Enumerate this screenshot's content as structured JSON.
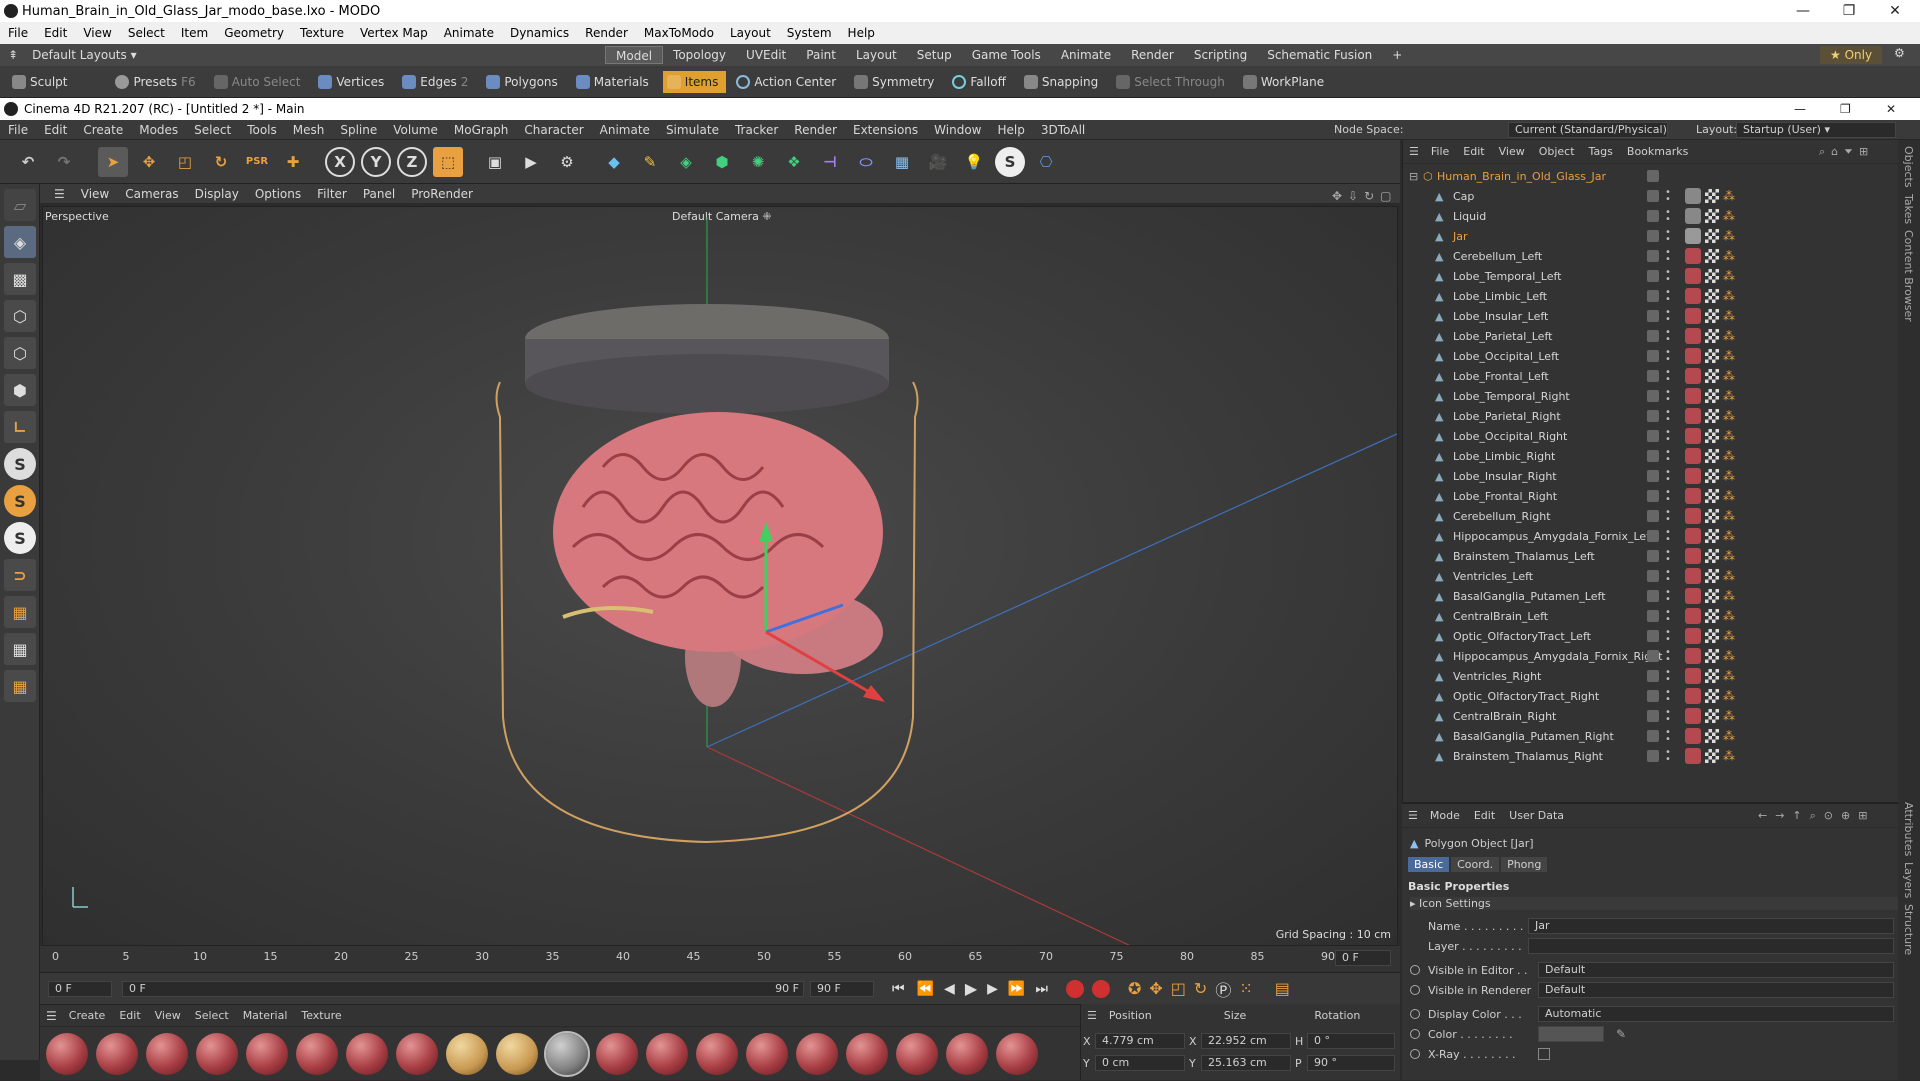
{
  "modo": {
    "title": "Human_Brain_in_Old_Glass_Jar_modo_base.lxo - MODO",
    "menu": [
      "File",
      "Edit",
      "View",
      "Select",
      "Item",
      "Geometry",
      "Texture",
      "Vertex Map",
      "Animate",
      "Dynamics",
      "Render",
      "MaxToModo",
      "Layout",
      "System",
      "Help"
    ],
    "layout_label": "Default Layouts",
    "tabs": [
      "Model",
      "Topology",
      "UVEdit",
      "Paint",
      "Layout",
      "Setup",
      "Game Tools",
      "Animate",
      "Render",
      "Scripting",
      "Schematic Fusion"
    ],
    "only_label": "Only",
    "tools": [
      "Sculpt",
      "Presets",
      "Auto Select",
      "Vertices",
      "Edges",
      "Polygons",
      "Materials",
      "Items",
      "Action Center",
      "Symmetry",
      "Falloff",
      "Snapping",
      "Select Through",
      "WorkPlane"
    ],
    "presets_key": "F6",
    "edges_count": "2"
  },
  "c4d": {
    "title": "Cinema 4D R21.207 (RC) - [Untitled 2 *] - Main",
    "menu": [
      "File",
      "Edit",
      "Create",
      "Modes",
      "Select",
      "Tools",
      "Mesh",
      "Spline",
      "Volume",
      "MoGraph",
      "Character",
      "Animate",
      "Simulate",
      "Tracker",
      "Render",
      "Extensions",
      "Window",
      "Help",
      "3DToAll"
    ],
    "node_space_label": "Node Space:",
    "node_space_value": "Current (Standard/Physical)",
    "layout_label": "Layout:",
    "layout_value": "Startup (User)"
  },
  "viewport": {
    "menu": [
      "View",
      "Cameras",
      "Display",
      "Options",
      "Filter",
      "Panel",
      "ProRender"
    ],
    "label": "Perspective",
    "camera": "Default Camera",
    "grid": "Grid Spacing : 10 cm"
  },
  "timeline": {
    "ticks": [
      "0",
      "5",
      "10",
      "15",
      "20",
      "25",
      "30",
      "35",
      "40",
      "45",
      "50",
      "55",
      "60",
      "65",
      "70",
      "75",
      "80",
      "85",
      "90"
    ],
    "end": "0 F",
    "start_field": "0 F",
    "range_start": "0 F",
    "range_end": "90 F",
    "end_field": "90 F"
  },
  "materials": {
    "menu": [
      "Create",
      "Edit",
      "View",
      "Select",
      "Material",
      "Texture"
    ]
  },
  "coords": {
    "headers": [
      "Position",
      "Size",
      "Rotation"
    ],
    "x_pos": "4.779 cm",
    "x_size": "22.952 cm",
    "h_rot": "0 °",
    "y_pos": "0 cm",
    "y_size": "25.163 cm",
    "p_rot": "90 °",
    "x": "X",
    "y": "Y",
    "h": "H",
    "p": "P"
  },
  "objects": {
    "menu": [
      "File",
      "Edit",
      "View",
      "Object",
      "Tags",
      "Bookmarks"
    ],
    "root": "Human_Brain_in_Old_Glass_Jar",
    "items": [
      "Cap",
      "Liquid",
      "Jar",
      "Cerebellum_Left",
      "Lobe_Temporal_Left",
      "Lobe_Limbic_Left",
      "Lobe_Insular_Left",
      "Lobe_Parietal_Left",
      "Lobe_Occipital_Left",
      "Lobe_Frontal_Left",
      "Lobe_Temporal_Right",
      "Lobe_Parietal_Right",
      "Lobe_Occipital_Right",
      "Lobe_Limbic_Right",
      "Lobe_Insular_Right",
      "Lobe_Frontal_Right",
      "Cerebellum_Right",
      "Hippocampus_Amygdala_Fornix_Left",
      "Brainstem_Thalamus_Left",
      "Ventricles_Left",
      "BasalGanglia_Putamen_Left",
      "CentralBrain_Left",
      "Optic_OlfactoryTract_Left",
      "Hippocampus_Amygdala_Fornix_Right",
      "Ventricles_Right",
      "Optic_OlfactoryTract_Right",
      "CentralBrain_Right",
      "BasalGanglia_Putamen_Right",
      "Brainstem_Thalamus_Right"
    ]
  },
  "attributes": {
    "menu": [
      "Mode",
      "Edit",
      "User Data"
    ],
    "object_label": "Polygon Object [Jar]",
    "tabs": [
      "Basic",
      "Coord.",
      "Phong"
    ],
    "section": "Basic Properties",
    "icon_settings": "Icon Settings",
    "name_label": "Name . . . . . . . . .",
    "name_value": "Jar",
    "layer_label": "Layer . . . . . . . . .",
    "vis_editor_label": "Visible in Editor . .",
    "vis_editor_value": "Default",
    "vis_render_label": "Visible in Renderer",
    "vis_render_value": "Default",
    "display_color_label": "Display Color . . .",
    "display_color_value": "Automatic",
    "color_label": "Color . . . . . . . .",
    "xray_label": "X-Ray . . . . . . . ."
  },
  "right_tabs": [
    "Objects",
    "Takes",
    "Content Browser",
    "Attributes",
    "Layers",
    "Structure"
  ]
}
